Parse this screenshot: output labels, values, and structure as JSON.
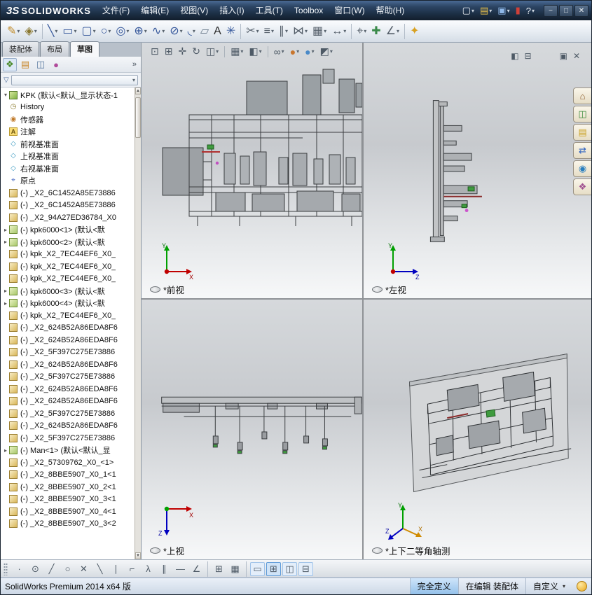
{
  "titlebar": {
    "logo_mark": "3S",
    "logo_text": "SOLIDWORKS",
    "menus": [
      {
        "name": "menu-file",
        "label": "文件(F)"
      },
      {
        "name": "menu-edit",
        "label": "编辑(E)"
      },
      {
        "name": "menu-view",
        "label": "视图(V)"
      },
      {
        "name": "menu-insert",
        "label": "插入(I)"
      },
      {
        "name": "menu-tools",
        "label": "工具(T)"
      },
      {
        "name": "menu-toolbox",
        "label": "Toolbox"
      },
      {
        "name": "menu-window",
        "label": "窗口(W)"
      },
      {
        "name": "menu-help",
        "label": "帮助(H)"
      }
    ],
    "quick_icons": [
      {
        "name": "new-document-icon",
        "glyph": "▢",
        "color": "#e8edf2",
        "dd": true
      },
      {
        "name": "open-document-icon",
        "glyph": "▤",
        "color": "#e8c04a",
        "dd": true
      },
      {
        "name": "save-icon",
        "glyph": "▣",
        "color": "#8fb8e8",
        "dd": true
      },
      {
        "name": "status-toggle-icon",
        "glyph": "▮",
        "color": "#d04038"
      },
      {
        "name": "help-icon",
        "glyph": "?",
        "color": "#e8edf2",
        "dd": true
      }
    ],
    "window_buttons": [
      {
        "name": "minimize-button",
        "glyph": "−"
      },
      {
        "name": "maximize-button",
        "glyph": "□"
      },
      {
        "name": "close-button",
        "glyph": "✕"
      }
    ]
  },
  "sketch_toolbar": [
    {
      "name": "sketch-icon",
      "glyph": "✎",
      "color": "#c08a28",
      "dd": true
    },
    {
      "name": "smart-dimension-icon",
      "glyph": "◈",
      "color": "#8a7830",
      "dd": true
    },
    {
      "sep": true
    },
    {
      "name": "line-icon",
      "glyph": "╲",
      "color": "#34569a",
      "dd": true
    },
    {
      "name": "rectangle-icon",
      "glyph": "▭",
      "color": "#34569a",
      "dd": true
    },
    {
      "name": "slot-icon",
      "glyph": "▢",
      "color": "#34569a",
      "dd": true
    },
    {
      "name": "circle-icon",
      "glyph": "○",
      "color": "#34569a",
      "dd": true
    },
    {
      "name": "spiral-icon",
      "glyph": "◎",
      "color": "#34569a",
      "dd": true
    },
    {
      "name": "perimeter-circle-icon",
      "glyph": "⊕",
      "color": "#34569a",
      "dd": true
    },
    {
      "name": "spline-icon",
      "glyph": "∿",
      "color": "#34569a",
      "dd": true
    },
    {
      "name": "ellipse-icon",
      "glyph": "⊘",
      "color": "#34569a",
      "dd": true
    },
    {
      "name": "fillet-icon",
      "glyph": "◟",
      "color": "#34569a",
      "dd": true
    },
    {
      "name": "plane-icon",
      "glyph": "▱",
      "color": "#6a7a8a"
    },
    {
      "name": "text-icon",
      "glyph": "A",
      "color": "#2a2a2a"
    },
    {
      "name": "point-icon",
      "glyph": "✳",
      "color": "#34569a"
    },
    {
      "sep": true
    },
    {
      "name": "trim-entities-icon",
      "glyph": "✂",
      "color": "#555f6a",
      "dd": true
    },
    {
      "name": "convert-entities-icon",
      "glyph": "≡",
      "color": "#555f6a",
      "dd": true
    },
    {
      "name": "offset-entities-icon",
      "glyph": "∥",
      "color": "#555f6a",
      "dd": true
    },
    {
      "name": "mirror-entities-icon",
      "glyph": "⋈",
      "color": "#555f6a",
      "dd": true
    },
    {
      "name": "linear-pattern-icon",
      "glyph": "▦",
      "color": "#555f6a",
      "dd": true
    },
    {
      "name": "move-entities-icon",
      "glyph": "↔",
      "color": "#555f6a",
      "dd": true
    },
    {
      "sep": true
    },
    {
      "name": "display-relations-icon",
      "glyph": "⌖",
      "color": "#555f6a",
      "dd": true
    },
    {
      "name": "repair-sketch-icon",
      "glyph": "✚",
      "color": "#3a8a4a"
    },
    {
      "name": "quick-snaps-icon",
      "glyph": "∠",
      "color": "#555f6a",
      "dd": true
    },
    {
      "sep": true
    },
    {
      "name": "instant3d-icon",
      "glyph": "✦",
      "color": "#d8a020"
    }
  ],
  "left_panel": {
    "tabs": [
      {
        "name": "tab-assembly",
        "label": "装配体",
        "active": false
      },
      {
        "name": "tab-layout",
        "label": "布局",
        "active": false
      },
      {
        "name": "tab-sketch",
        "label": "草图",
        "active": true
      }
    ],
    "overflow_chevron": "»"
  },
  "manager_tabs": [
    {
      "name": "feature-manager-tab-icon",
      "glyph": "❖",
      "color": "#4a8a2a"
    },
    {
      "name": "property-manager-tab-icon",
      "glyph": "▤",
      "color": "#c9872a"
    },
    {
      "name": "configuration-manager-tab-icon",
      "glyph": "◫",
      "color": "#5a7aa0"
    },
    {
      "name": "display-manager-tab-icon",
      "glyph": "●",
      "color": "#b04a9a"
    }
  ],
  "tree": {
    "root": "KPK (默认<默认_显示状态-1",
    "icon_glyphs": {
      "history": "◷",
      "sensor": "◉",
      "annotation": "A",
      "plane": "◇",
      "origin": "⌖",
      "part": "",
      "asm": ""
    },
    "items": [
      {
        "icon": "history",
        "label": "History"
      },
      {
        "icon": "sensor",
        "label": "传感器"
      },
      {
        "icon": "annotation",
        "label": "注解"
      },
      {
        "icon": "plane",
        "label": "前视基准面"
      },
      {
        "icon": "plane",
        "label": "上视基准面"
      },
      {
        "icon": "plane",
        "label": "右视基准面"
      },
      {
        "icon": "origin",
        "label": "原点"
      },
      {
        "icon": "part",
        "label": "(-) _X2_6C1452A85E73886"
      },
      {
        "icon": "part",
        "label": "(-) _X2_6C1452A85E73886"
      },
      {
        "icon": "part",
        "label": "(-) _X2_94A27ED36784_X0"
      },
      {
        "icon": "asm",
        "label": "(-) kpk6000<1> (默认<默",
        "expand": true
      },
      {
        "icon": "asm",
        "label": "(-) kpk6000<2> (默认<默",
        "expand": true
      },
      {
        "icon": "part",
        "label": "(-) kpk_X2_7EC44EF6_X0_"
      },
      {
        "icon": "part",
        "label": "(-) kpk_X2_7EC44EF6_X0_"
      },
      {
        "icon": "part",
        "label": "(-) kpk_X2_7EC44EF6_X0_"
      },
      {
        "icon": "asm",
        "label": "(-) kpk6000<3> (默认<默",
        "expand": true
      },
      {
        "icon": "asm",
        "label": "(-) kpk6000<4> (默认<默",
        "expand": true
      },
      {
        "icon": "part",
        "label": "(-) kpk_X2_7EC44EF6_X0_"
      },
      {
        "icon": "part",
        "label": "(-) _X2_624B52A86EDA8F6"
      },
      {
        "icon": "part",
        "label": "(-) _X2_624B52A86EDA8F6"
      },
      {
        "icon": "part",
        "label": "(-) _X2_5F397C275E73886"
      },
      {
        "icon": "part",
        "label": "(-) _X2_624B52A86EDA8F6"
      },
      {
        "icon": "part",
        "label": "(-) _X2_5F397C275E73886"
      },
      {
        "icon": "part",
        "label": "(-) _X2_624B52A86EDA8F6"
      },
      {
        "icon": "part",
        "label": "(-) _X2_624B52A86EDA8F6"
      },
      {
        "icon": "part",
        "label": "(-) _X2_5F397C275E73886"
      },
      {
        "icon": "part",
        "label": "(-) _X2_624B52A86EDA8F6"
      },
      {
        "icon": "part",
        "label": "(-) _X2_5F397C275E73886"
      },
      {
        "icon": "asm",
        "label": "(-) Man<1> (默认<默认_显",
        "expand": true
      },
      {
        "icon": "part",
        "label": "(-) _X2_57309762_X0_<1>"
      },
      {
        "icon": "part",
        "label": "(-) _X2_8BBE5907_X0_1<1"
      },
      {
        "icon": "part",
        "label": "(-) _X2_8BBE5907_X0_2<1"
      },
      {
        "icon": "part",
        "label": "(-) _X2_8BBE5907_X0_3<1"
      },
      {
        "icon": "part",
        "label": "(-) _X2_8BBE5907_X0_4<1"
      },
      {
        "icon": "part",
        "label": "(-) _X2_8BBE5907_X0_3<2"
      }
    ]
  },
  "viewport_toolbar": [
    {
      "name": "zoom-fit-icon",
      "glyph": "⊡"
    },
    {
      "name": "zoom-area-icon",
      "glyph": "⊞"
    },
    {
      "name": "pan-icon",
      "glyph": "✛"
    },
    {
      "name": "rotate-view-icon",
      "glyph": "↻"
    },
    {
      "name": "section-view-icon",
      "glyph": "◫",
      "dd": true
    },
    {
      "sep": true
    },
    {
      "name": "view-orientation-icon",
      "glyph": "▦",
      "dd": true
    },
    {
      "name": "display-style-icon",
      "glyph": "◧",
      "dd": true
    },
    {
      "sep": true
    },
    {
      "name": "hide-show-items-icon",
      "glyph": "∞",
      "dd": true
    },
    {
      "name": "edit-appearance-icon",
      "glyph": "●",
      "color": "#c8762e",
      "dd": true
    },
    {
      "name": "apply-scene-icon",
      "glyph": "●",
      "color": "#4a8ac8",
      "dd": true
    },
    {
      "name": "view-settings-icon",
      "glyph": "◩",
      "dd": true
    }
  ],
  "pane_controls": [
    {
      "name": "split-pane-icon",
      "glyph": "◧"
    },
    {
      "name": "pane-display-icon",
      "glyph": "⊟"
    },
    {
      "sep": true
    },
    {
      "name": "popout-pane-icon",
      "glyph": "▣"
    },
    {
      "name": "close-pane-icon",
      "glyph": "✕"
    }
  ],
  "task_pane": [
    {
      "name": "home-icon",
      "glyph": "⌂",
      "color": "#8a5a2a"
    },
    {
      "name": "design-library-icon",
      "glyph": "◫",
      "color": "#3a8a3a"
    },
    {
      "name": "file-explorer-icon",
      "glyph": "▤",
      "color": "#c9a227"
    },
    {
      "name": "view-palette-icon",
      "glyph": "⇄",
      "color": "#2a5fbf"
    },
    {
      "name": "appearances-icon",
      "glyph": "◉",
      "color": "#2a7fbf"
    },
    {
      "name": "custom-properties-icon",
      "glyph": "❖",
      "color": "#a05090"
    }
  ],
  "snap_toolbar": [
    {
      "name": "snap-points-icon",
      "glyph": "∙"
    },
    {
      "name": "snap-center-icon",
      "glyph": "⊙"
    },
    {
      "name": "snap-line-icon",
      "glyph": "╱"
    },
    {
      "name": "snap-circle-icon",
      "glyph": "○"
    },
    {
      "name": "snap-intersection-icon",
      "glyph": "✕"
    },
    {
      "name": "snap-nearest-icon",
      "glyph": "╲"
    },
    {
      "name": "snap-vertical-icon",
      "glyph": "∣"
    },
    {
      "name": "snap-perpendicular-icon",
      "glyph": "⌐"
    },
    {
      "name": "snap-tangent-icon",
      "glyph": "λ"
    },
    {
      "name": "snap-parallel-icon",
      "glyph": "∥"
    },
    {
      "name": "snap-horizontal-icon",
      "glyph": "—"
    },
    {
      "name": "snap-angle-icon",
      "glyph": "∠"
    },
    {
      "sep": true
    },
    {
      "name": "grid-snap-icon",
      "glyph": "⊞"
    },
    {
      "name": "grid-settings-icon",
      "glyph": "▦"
    },
    {
      "sep": true
    },
    {
      "name": "single-viewport-icon",
      "glyph": "▭",
      "light": true
    },
    {
      "name": "four-viewport-icon",
      "glyph": "⊞",
      "selected": true
    },
    {
      "name": "two-viewport-vertical-icon",
      "glyph": "◫",
      "light": true
    },
    {
      "name": "two-viewport-horizontal-icon",
      "glyph": "⊟",
      "light": true
    }
  ],
  "viewport": {
    "views": [
      {
        "label": "*前视"
      },
      {
        "label": "*左视"
      },
      {
        "label": "*上视"
      },
      {
        "label": "*上下二等角轴测"
      }
    ]
  },
  "statusbar": {
    "product": "SolidWorks Premium 2014 x64 版",
    "define_status": "完全定义",
    "edit_status": "在编辑 装配体",
    "custom": "自定义"
  }
}
